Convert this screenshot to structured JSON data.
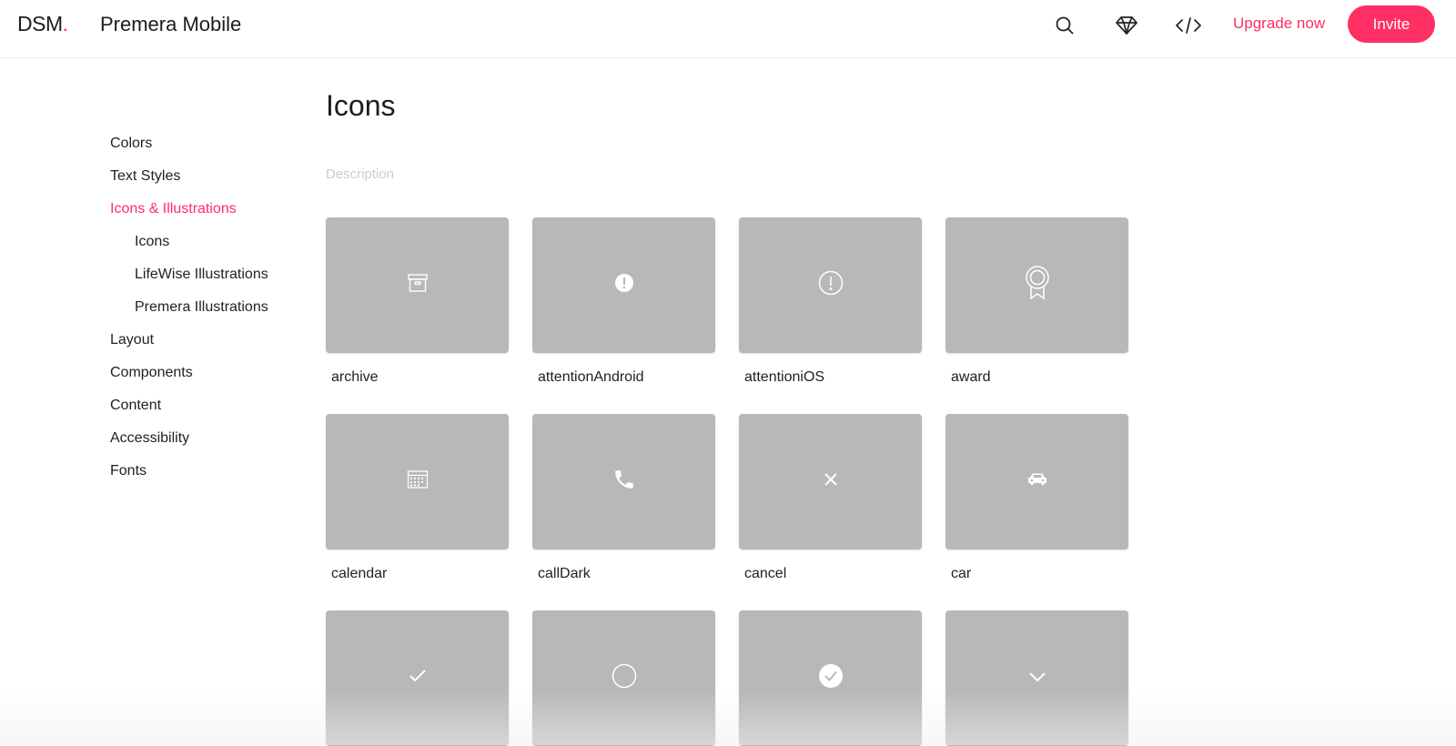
{
  "header": {
    "logo_text": "DSM",
    "logo_dot": ".",
    "project_name": "Premera Mobile",
    "search_icon": "search-icon",
    "sketch_icon": "diamond-icon",
    "code_icon": "code-icon",
    "upgrade_label": "Upgrade now",
    "invite_label": "Invite",
    "accent_color": "#ff2e63"
  },
  "sidebar": {
    "items": [
      {
        "label": "Colors",
        "active": false,
        "level": 1
      },
      {
        "label": "Text Styles",
        "active": false,
        "level": 1
      },
      {
        "label": "Icons & Illustrations",
        "active": true,
        "level": 1
      },
      {
        "label": "Icons",
        "active": false,
        "level": 2
      },
      {
        "label": "LifeWise Illustrations",
        "active": false,
        "level": 2
      },
      {
        "label": "Premera Illustrations",
        "active": false,
        "level": 2
      },
      {
        "label": "Layout",
        "active": false,
        "level": 1
      },
      {
        "label": "Components",
        "active": false,
        "level": 1
      },
      {
        "label": "Content",
        "active": false,
        "level": 1
      },
      {
        "label": "Accessibility",
        "active": false,
        "level": 1
      },
      {
        "label": "Fonts",
        "active": false,
        "level": 1
      }
    ]
  },
  "main": {
    "title": "Icons",
    "description_placeholder": "Description",
    "icons": [
      {
        "name": "archive",
        "icon": "archive-icon"
      },
      {
        "name": "attentionAndroid",
        "icon": "attention-filled-icon"
      },
      {
        "name": "attentioniOS",
        "icon": "attention-outline-icon"
      },
      {
        "name": "award",
        "icon": "award-icon"
      },
      {
        "name": "calendar",
        "icon": "calendar-icon"
      },
      {
        "name": "callDark",
        "icon": "phone-icon"
      },
      {
        "name": "cancel",
        "icon": "close-icon"
      },
      {
        "name": "car",
        "icon": "car-icon"
      },
      {
        "name": "",
        "icon": "checkmark-icon"
      },
      {
        "name": "",
        "icon": "circle-icon"
      },
      {
        "name": "",
        "icon": "check-circle-icon"
      },
      {
        "name": "",
        "icon": "chevron-down-icon"
      }
    ],
    "tile_color": "#b8b8b8"
  }
}
